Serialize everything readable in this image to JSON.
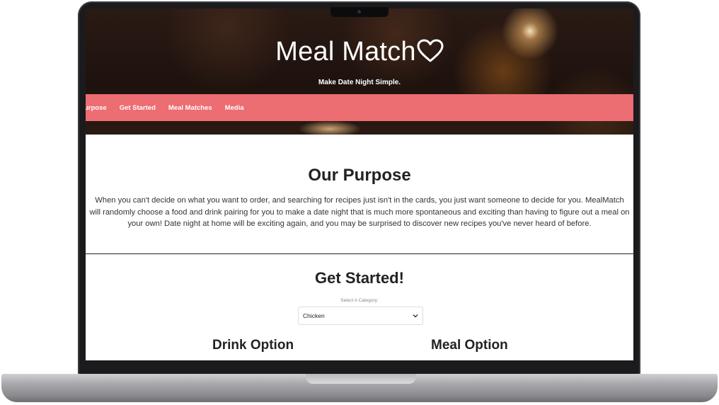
{
  "hero": {
    "title": "Meal Match",
    "tagline": "Make Date Night Simple."
  },
  "nav": {
    "items": [
      {
        "label": "urpose"
      },
      {
        "label": "Get Started"
      },
      {
        "label": "Meal Matches"
      },
      {
        "label": "Media"
      }
    ]
  },
  "purpose": {
    "title": "Our Purpose",
    "body": "When you can't decide on what you want to order, and searching for recipes just isn't in the cards, you just want someone to decide for you. MealMatch will randomly choose a food and drink pairing for you to make a date night that is much more spontaneous and exciting than having to figure out a meal on your own! Date night at home will be exciting again, and you may be surprised to discover new recipes you've never heard of before."
  },
  "get_started": {
    "title": "Get Started!",
    "select_label": "Select A Category:",
    "select_value": "Chicken",
    "drink_title": "Drink Option",
    "meal_title": "Meal Option"
  },
  "colors": {
    "nav_background": "#ec6d72",
    "hero_text": "#ffffff",
    "body_text": "#222222"
  },
  "icons": {
    "title_icon": "heart-outline-icon",
    "select_icon": "chevron-down-icon"
  }
}
